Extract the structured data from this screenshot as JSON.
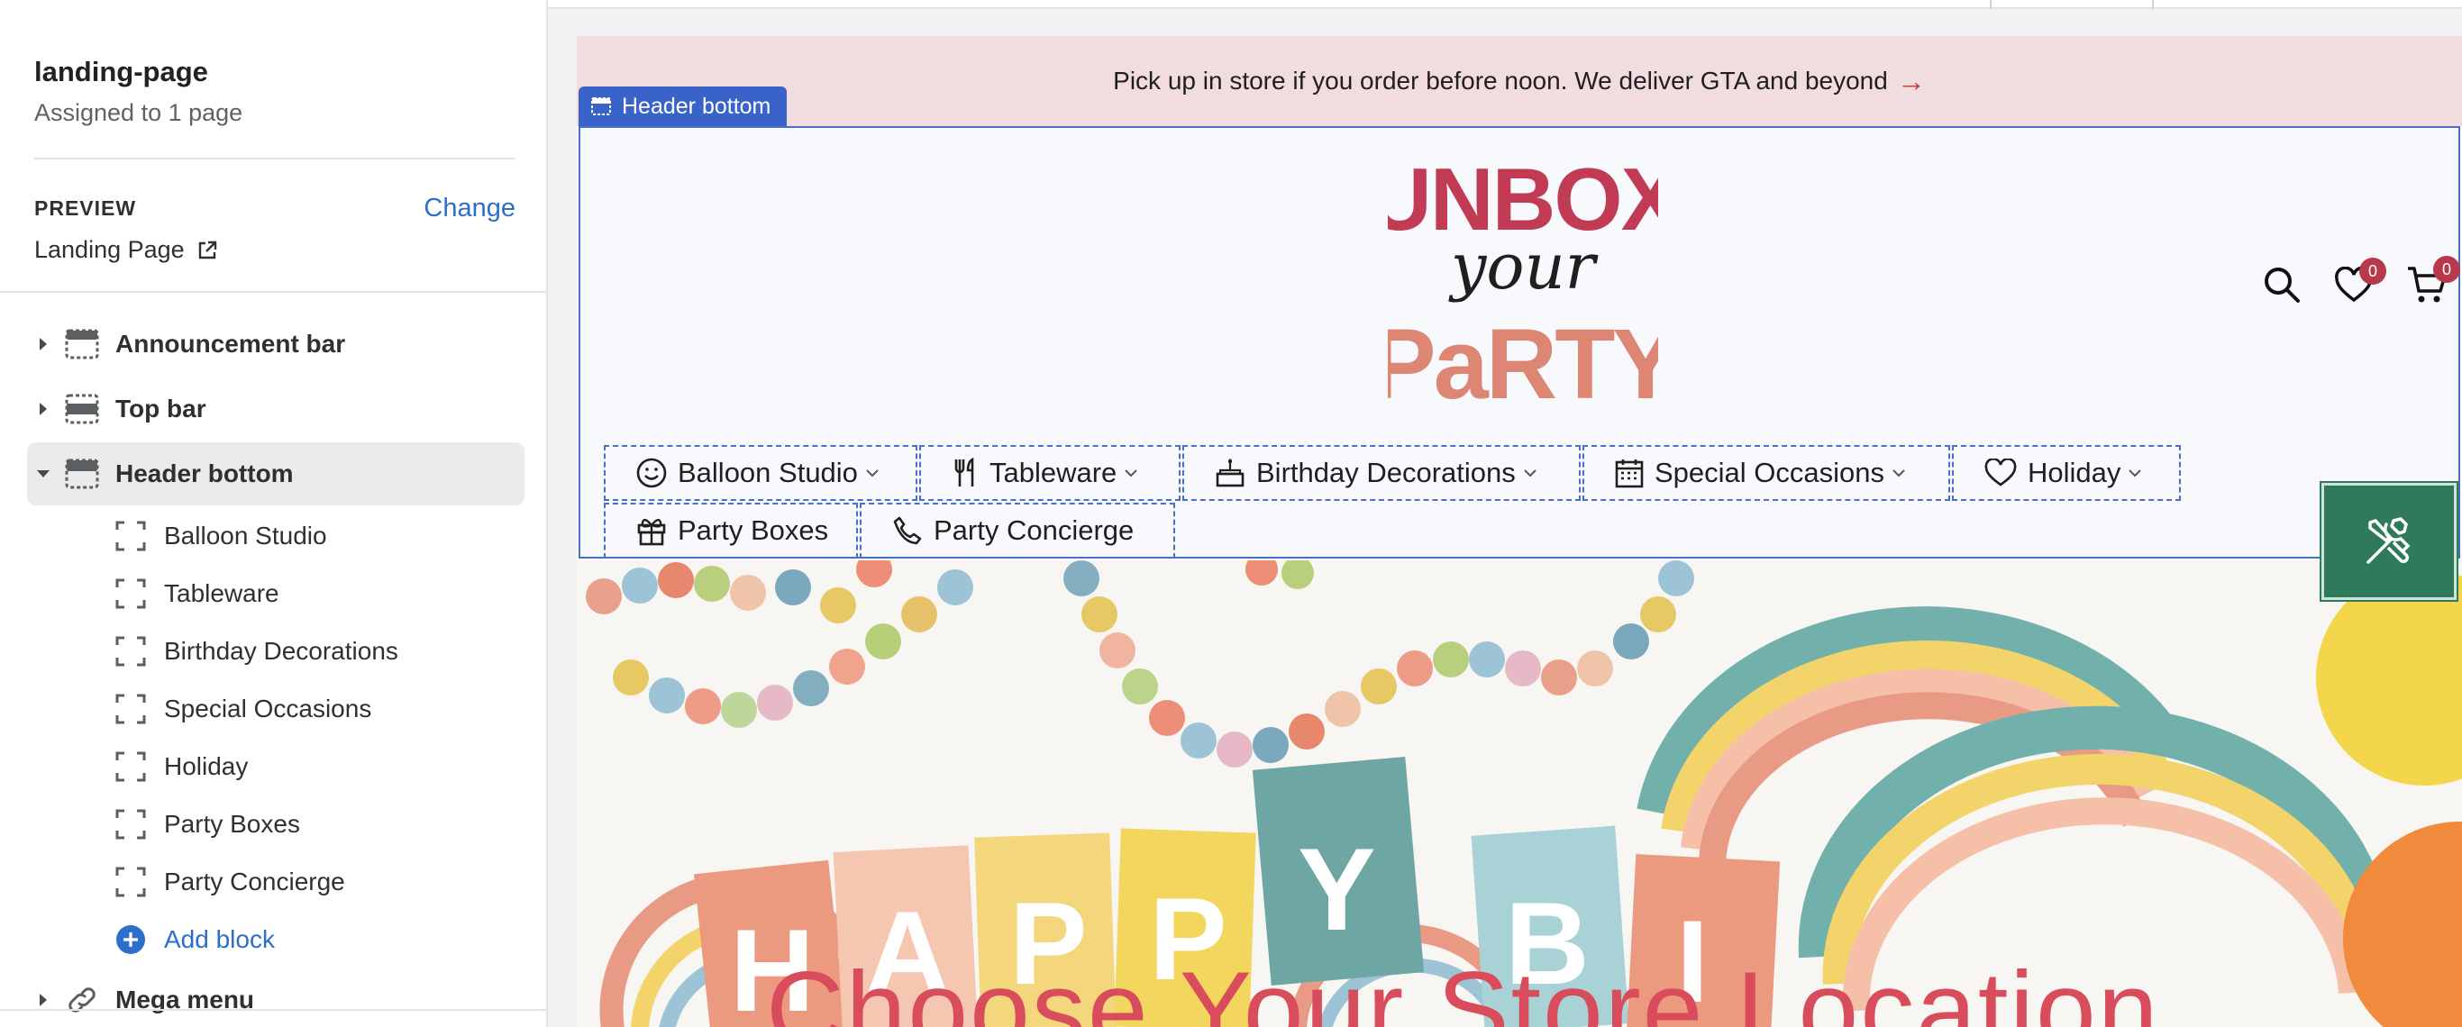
{
  "sidebar": {
    "template_name": "landing-page",
    "assigned_text": "Assigned to 1 page",
    "preview_label": "PREVIEW",
    "change_label": "Change",
    "preview_page": "Landing Page",
    "sections": {
      "announcement_bar": "Announcement bar",
      "top_bar": "Top bar",
      "header_bottom": "Header bottom",
      "mega_menu": "Mega menu"
    },
    "blocks": [
      "Balloon Studio",
      "Tableware",
      "Birthday Decorations",
      "Special Occasions",
      "Holiday",
      "Party Boxes",
      "Party Concierge"
    ],
    "add_block_label": "Add block"
  },
  "preview": {
    "announcement_text": "Pick up in store if you order before noon. We deliver GTA and beyond",
    "announcement_arrow": "→",
    "selected_section_tag": "Header bottom",
    "logo": {
      "line1": "UNBOX",
      "line2": "your",
      "line3": "PaRTY"
    },
    "wishlist_count": "0",
    "cart_count": "0",
    "nav": {
      "balloon_studio": "Balloon Studio",
      "tableware": "Tableware",
      "birthday_decorations": "Birthday Decorations",
      "special_occasions": "Special Occasions",
      "holiday": "Holiday",
      "party_boxes": "Party Boxes",
      "party_concierge": "Party Concierge"
    },
    "hero_letters": [
      "H",
      "A",
      "P",
      "P",
      "Y",
      "B",
      "I"
    ],
    "hero_title": "Choose Your Store Location"
  },
  "colors": {
    "accent_blue": "#2c6ecb",
    "selection_blue": "#4a6fc8",
    "announcement_bg": "#f1dde0",
    "badge": "#b8394a",
    "hero_title": "#d94c5c",
    "fab_green": "#2e7a5a"
  },
  "icons": {
    "section_header": "layout-section-icon",
    "block": "block-bracket-icon",
    "add": "plus-circle-icon",
    "mega_menu": "link-icon",
    "search": "search-icon",
    "wishlist": "heart-icon",
    "cart": "cart-icon",
    "fab": "tools-icon"
  }
}
